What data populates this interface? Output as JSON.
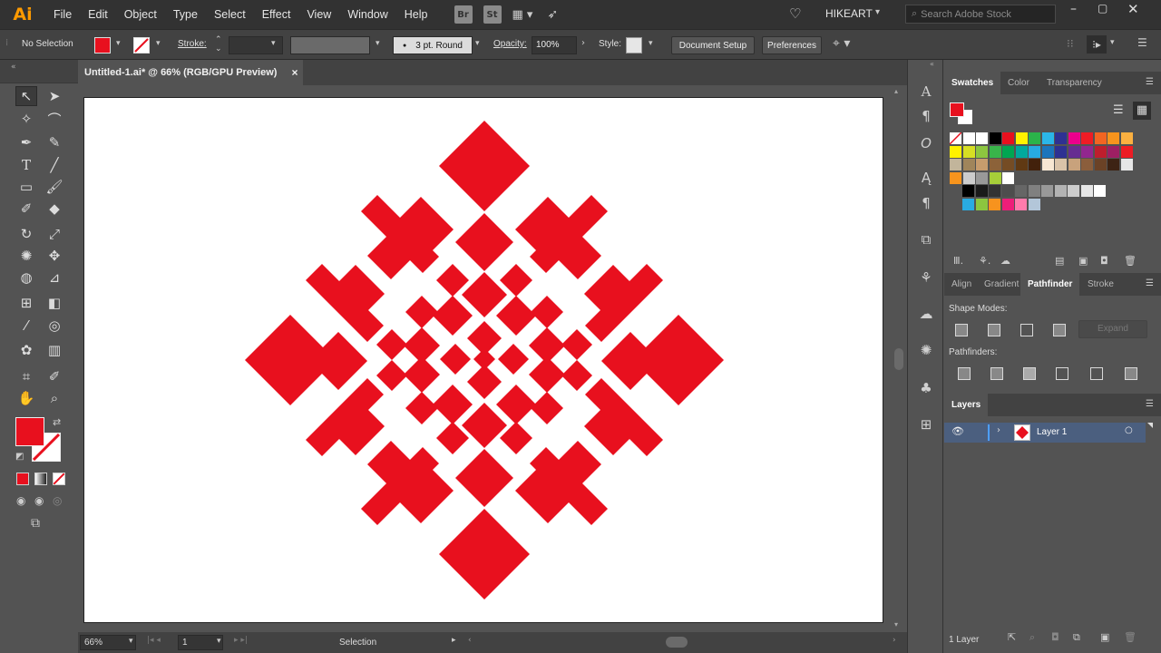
{
  "app": {
    "logo": "Ai"
  },
  "menu": [
    "File",
    "Edit",
    "Object",
    "Type",
    "Select",
    "Effect",
    "View",
    "Window",
    "Help"
  ],
  "menubar_icons": [
    "Br",
    "St"
  ],
  "workspace": "HIKEART",
  "search": {
    "placeholder": "Search Adobe Stock"
  },
  "control": {
    "selection": "No Selection",
    "stroke_label": "Stroke:",
    "brush": "3 pt. Round",
    "opacity_label": "Opacity:",
    "opacity_value": "100%",
    "style_label": "Style:",
    "doc_setup": "Document Setup",
    "preferences": "Preferences"
  },
  "document": {
    "tab_title": "Untitled-1.ai* @ 66% (RGB/GPU Preview)",
    "close": "×"
  },
  "status": {
    "zoom": "66%",
    "artboard_num": "1",
    "tool": "Selection"
  },
  "panels": {
    "swatches_tabs": [
      "Swatches",
      "Color",
      "Transparency"
    ],
    "pathfinder_tabs": [
      "Align",
      "Gradient",
      "Pathfinder",
      "Stroke"
    ],
    "shape_modes": "Shape Modes:",
    "pathfinders": "Pathfinders:",
    "expand": "Expand",
    "layers_tab": "Layers",
    "layer_name": "Layer 1",
    "layer_count": "1 Layer"
  },
  "colors": {
    "fill": "#e8101e",
    "art": "#e8101e",
    "accent": "#ff9a00"
  }
}
